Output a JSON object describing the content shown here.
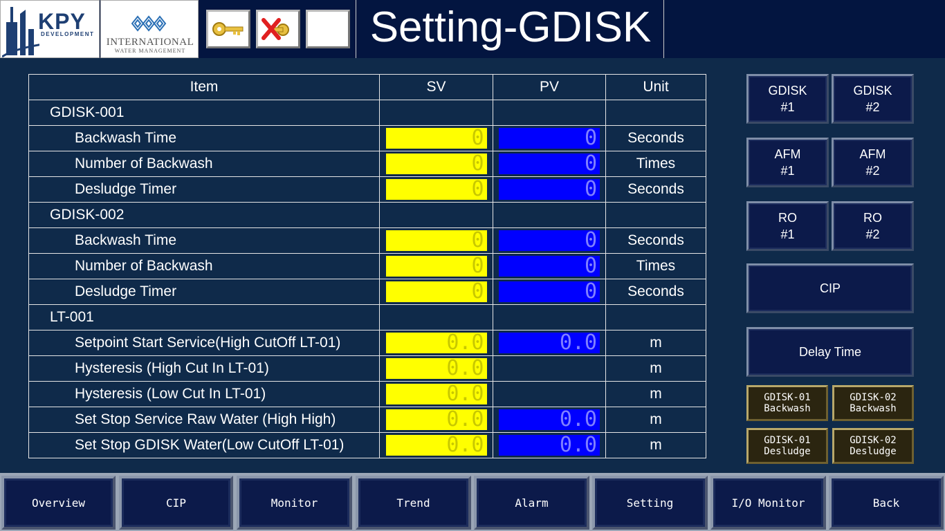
{
  "header": {
    "logo_kpy": "KPY",
    "logo_kpy_sub": "DEVELOPMENT",
    "logo_iwm_line1": "INTERNATIONAL",
    "logo_iwm_line2": "WATER MANAGEMENT",
    "title": "Setting-GDISK"
  },
  "table": {
    "headers": [
      "Item",
      "SV",
      "PV",
      "Unit"
    ],
    "groups": [
      {
        "label": "GDISK-001",
        "rows": [
          {
            "item": "Backwash Time",
            "sv": "0",
            "pv": "0",
            "unit": "Seconds"
          },
          {
            "item": "Number of Backwash",
            "sv": "0",
            "pv": "0",
            "unit": "Times"
          },
          {
            "item": "Desludge Timer",
            "sv": "0",
            "pv": "0",
            "unit": "Seconds"
          }
        ]
      },
      {
        "label": "GDISK-002",
        "rows": [
          {
            "item": "Backwash Time",
            "sv": "0",
            "pv": "0",
            "unit": "Seconds"
          },
          {
            "item": "Number of Backwash",
            "sv": "0",
            "pv": "0",
            "unit": "Times"
          },
          {
            "item": "Desludge Timer",
            "sv": "0",
            "pv": "0",
            "unit": "Seconds"
          }
        ]
      },
      {
        "label": "LT-001",
        "rows": [
          {
            "item": "Setpoint Start Service(High CutOff LT-01)",
            "sv": "0.0",
            "pv": "0.0",
            "unit": "m"
          },
          {
            "item": "Hysteresis (High Cut In LT-01)",
            "sv": "0.0",
            "pv": "",
            "unit": "m"
          },
          {
            "item": "Hysteresis (Low Cut In LT-01)",
            "sv": "0.0",
            "pv": "",
            "unit": "m"
          },
          {
            "item": "Set Stop Service Raw Water (High High)",
            "sv": "0.0",
            "pv": "0.0",
            "unit": "m"
          },
          {
            "item": "Set Stop GDISK Water(Low CutOff LT-01)",
            "sv": "0.0",
            "pv": "0.0",
            "unit": "m"
          }
        ]
      }
    ]
  },
  "side": {
    "gdisk1": [
      "GDISK",
      "#1"
    ],
    "gdisk2": [
      "GDISK",
      "#2"
    ],
    "afm1": [
      "AFM",
      "#1"
    ],
    "afm2": [
      "AFM",
      "#2"
    ],
    "ro1": [
      "RO",
      "#1"
    ],
    "ro2": [
      "RO",
      "#2"
    ],
    "cip": "CIP",
    "delay": "Delay Time",
    "g1_backwash": [
      "GDISK-01",
      "Backwash"
    ],
    "g2_backwash": [
      "GDISK-02",
      "Backwash"
    ],
    "g1_desludge": [
      "GDISK-01",
      "Desludge"
    ],
    "g2_desludge": [
      "GDISK-02",
      "Desludge"
    ]
  },
  "nav": [
    "Overview",
    "CIP",
    "Monitor",
    "Trend",
    "Alarm",
    "Setting",
    "I/O Monitor",
    "Back"
  ],
  "icons": {
    "login": "key-icon",
    "logout": "key-x-icon",
    "blank": "blank-button"
  },
  "colors": {
    "sv_bg": "#ffff00",
    "pv_bg": "#0000ff",
    "background": "#0f2a4a",
    "header": "#031540"
  }
}
